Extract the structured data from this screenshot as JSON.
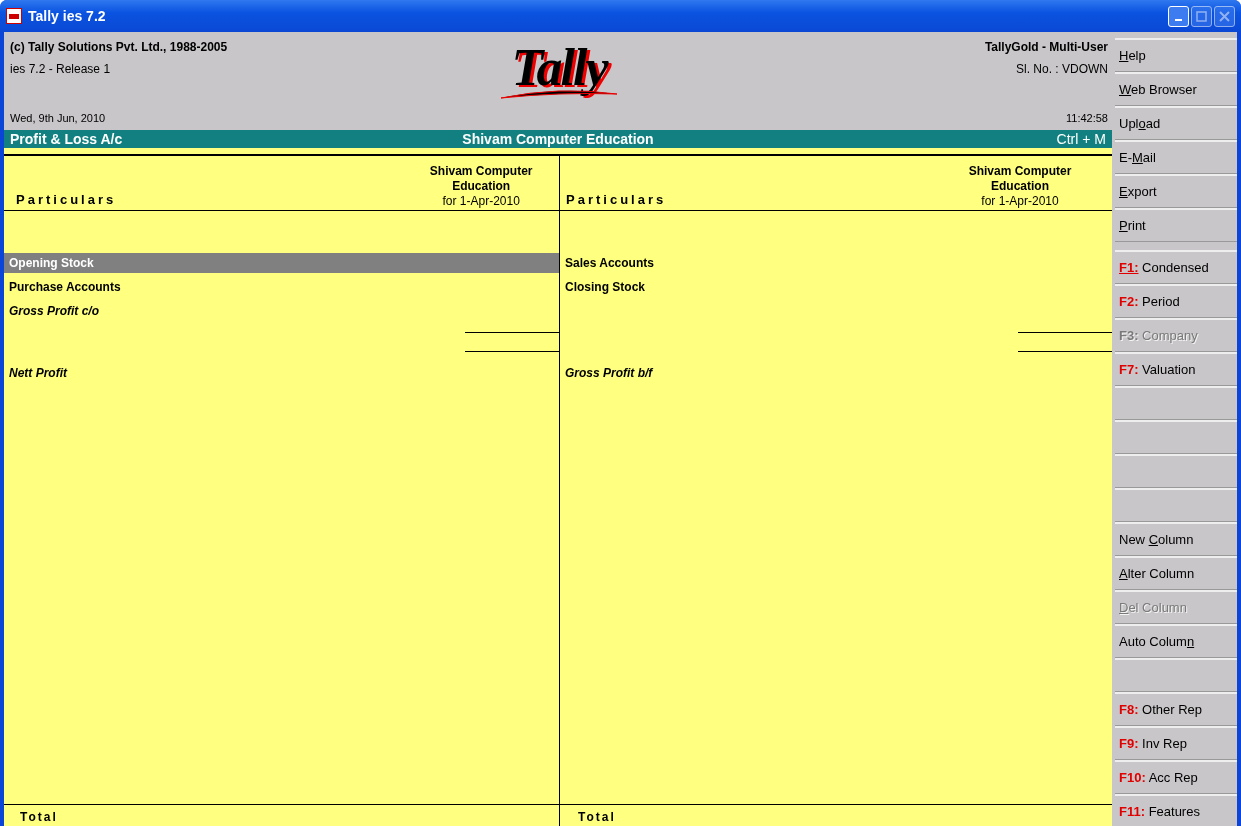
{
  "window": {
    "title": "Tally ies 7.2"
  },
  "header": {
    "copyright": "(c) Tally Solutions Pvt. Ltd., 1988-2005",
    "release": "ies 7.2 - Release 1",
    "date": "Wed, 9th Jun, 2010",
    "logo": "Tally",
    "edition": "TallyGold - Multi-User",
    "serial": "Sl. No. : VDOWN",
    "time": "11:42:58"
  },
  "report_bar": {
    "title": "Profit & Loss A/c",
    "company": "Shivam Computer Education",
    "shortcut": "Ctrl + M"
  },
  "sides": [
    {
      "heading": "Particulars",
      "column_heading": [
        "Shivam Computer",
        "Education"
      ],
      "column_period": "for 1-Apr-2010",
      "total": "Total",
      "rows": [
        {
          "kind": "blank"
        },
        {
          "kind": "entry",
          "text": "Opening Stock",
          "italic": false,
          "selected": true
        },
        {
          "kind": "entry",
          "text": "Purchase Accounts",
          "italic": false,
          "selected": false
        },
        {
          "kind": "entry",
          "text": "Gross Profit c/o",
          "italic": true,
          "selected": false
        },
        {
          "kind": "rule"
        },
        {
          "kind": "rule"
        },
        {
          "kind": "entry",
          "text": "Nett Profit",
          "italic": true,
          "selected": false
        }
      ]
    },
    {
      "heading": "Particulars",
      "column_heading": [
        "Shivam Computer",
        "Education"
      ],
      "column_period": "for 1-Apr-2010",
      "total": "Total",
      "rows": [
        {
          "kind": "blank"
        },
        {
          "kind": "entry",
          "text": "Sales Accounts",
          "italic": false,
          "selected": false
        },
        {
          "kind": "entry",
          "text": "Closing Stock",
          "italic": false,
          "selected": false
        },
        {
          "kind": "blank"
        },
        {
          "kind": "rule"
        },
        {
          "kind": "rule"
        },
        {
          "kind": "entry",
          "text": "Gross Profit b/f",
          "italic": true,
          "selected": false
        }
      ]
    }
  ],
  "buttons": [
    {
      "kind": "plain",
      "hot": "H",
      "post": "elp",
      "disabled": false
    },
    {
      "kind": "plain",
      "hot": "W",
      "post": "eb Browser",
      "disabled": false
    },
    {
      "kind": "plain",
      "pre": "Upl",
      "hot": "o",
      "post": "ad",
      "disabled": false
    },
    {
      "kind": "plain",
      "pre": "E-",
      "hot": "M",
      "post": "ail",
      "disabled": false
    },
    {
      "kind": "plain",
      "hot": "E",
      "post": "xport",
      "disabled": false
    },
    {
      "kind": "plain",
      "hot": "P",
      "post": "rint",
      "disabled": false
    },
    {
      "kind": "gap"
    },
    {
      "kind": "fkey",
      "key": "F1:",
      "key_underlined": true,
      "label": "Condensed",
      "disabled": false
    },
    {
      "kind": "fkey",
      "key": "F2:",
      "key_underlined": false,
      "label": "Period",
      "disabled": false
    },
    {
      "kind": "fkey",
      "key": "F3:",
      "key_underlined": false,
      "label": "Company",
      "disabled": true
    },
    {
      "kind": "fkey",
      "key": "F7:",
      "key_underlined": false,
      "label": "Valuation",
      "disabled": false
    },
    {
      "kind": "blank"
    },
    {
      "kind": "blank"
    },
    {
      "kind": "blank"
    },
    {
      "kind": "blank"
    },
    {
      "kind": "plain",
      "pre": "New ",
      "hot": "C",
      "post": "olumn",
      "disabled": false
    },
    {
      "kind": "plain",
      "hot": "A",
      "post": "lter Column",
      "disabled": false
    },
    {
      "kind": "plain",
      "hot": "D",
      "post": "el Column",
      "disabled": true
    },
    {
      "kind": "plain",
      "pre": "Auto Colum",
      "hot": "n",
      "disabled": false
    },
    {
      "kind": "blank"
    },
    {
      "kind": "fkey",
      "key": "F8:",
      "key_underlined": false,
      "label": "Other Rep",
      "disabled": false
    },
    {
      "kind": "fkey",
      "key": "F9:",
      "key_underlined": false,
      "label": "Inv Rep",
      "disabled": false
    },
    {
      "kind": "fkey",
      "key": "F10:",
      "key_underlined": false,
      "label": "Acc Rep",
      "disabled": false
    },
    {
      "kind": "fkey",
      "key": "F11:",
      "key_underlined": false,
      "label": "Features",
      "disabled": false
    }
  ]
}
